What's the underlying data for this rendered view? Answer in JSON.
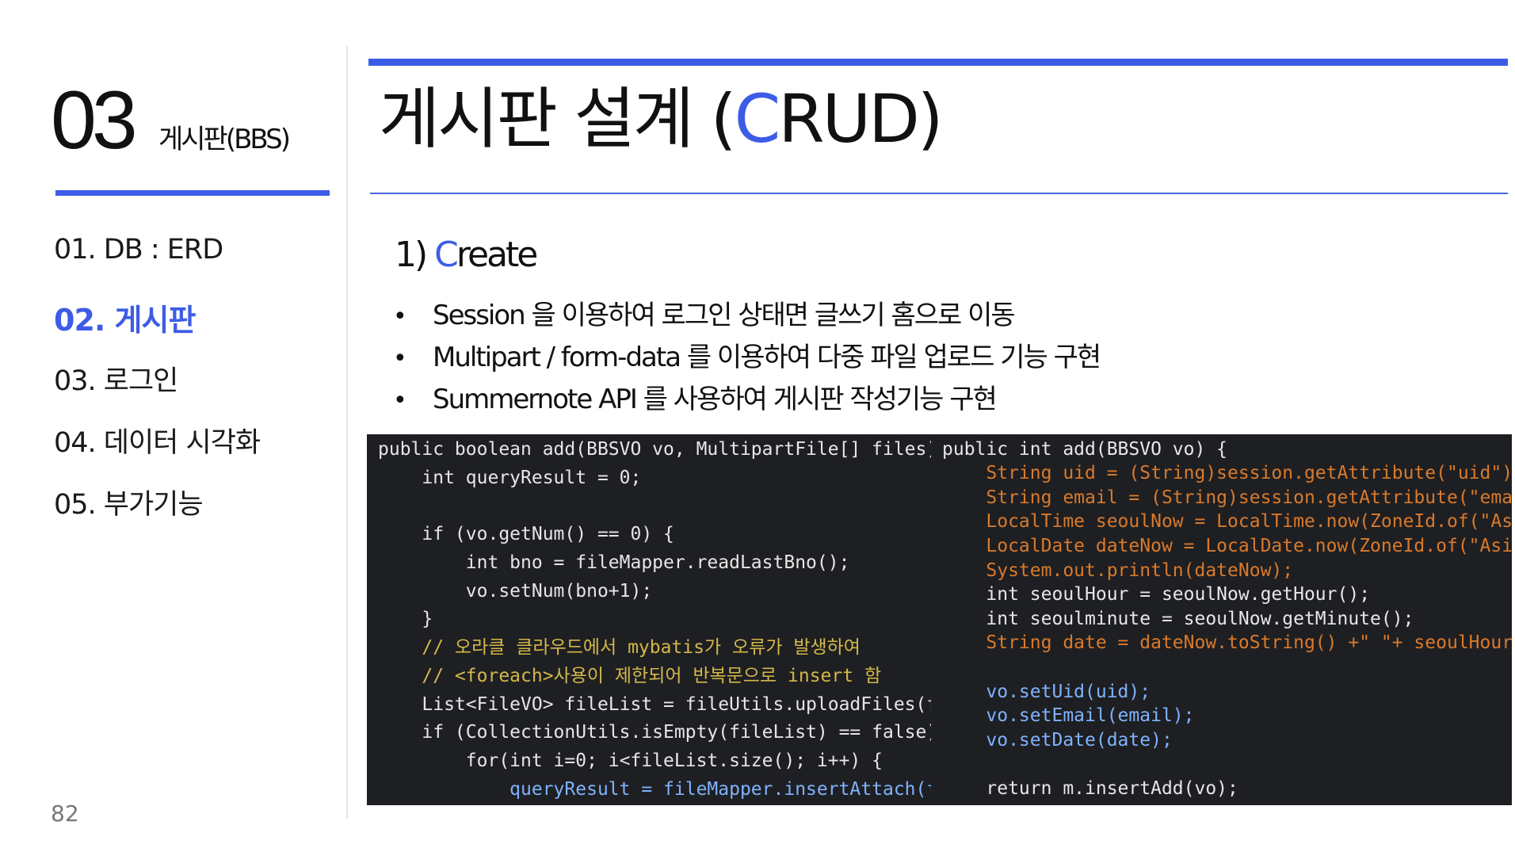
{
  "sidebar": {
    "section_number": "03",
    "section_name": "게시판(BBS)",
    "items": [
      {
        "label": "01. DB : ERD",
        "active": false
      },
      {
        "label": "02. 게시판",
        "active": true
      },
      {
        "label": "03. 로그인",
        "active": false
      },
      {
        "label": "04. 데이터 시각화",
        "active": false
      },
      {
        "label": "05. 부가기능",
        "active": false
      }
    ],
    "page_number": "82"
  },
  "header": {
    "title_prefix": "게시판 설계 (",
    "title_accent": "C",
    "title_suffix": "RUD)"
  },
  "content": {
    "sub_heading_prefix": "1) ",
    "sub_heading_accent": "C",
    "sub_heading_suffix": "reate",
    "bullets": [
      "Session 을 이용하여 로그인 상태면 글쓰기 홈으로 이동",
      "Multipart / form-data 를 이용하여 다중 파일 업로드 기능 구현",
      "Summernote API 를 사용하여 게시판 작성기능 구현"
    ],
    "bullet_symbol": "•"
  },
  "code_left": [
    "public boolean add(BBSVO vo, MultipartFile[] files) {",
    "    int queryResult = 0;",
    "",
    "    if (vo.getNum() == 0) {",
    "        int bno = fileMapper.readLastBno();",
    "        vo.setNum(bno+1);",
    "    }",
    "    // 오라클 클라우드에서 mybatis가 오류가 발생하여",
    "    // <foreach>사용이 제한되어 반복문으로 insert 함",
    "    List<FileVO> fileList = fileUtils.uploadFiles(files, vo.getNum());",
    "    if (CollectionUtils.isEmpty(fileList) == false) {",
    "        for(int i=0; i<fileList.size(); i++) {",
    "            queryResult = fileMapper.insertAttach(fileList.get(i));"
  ],
  "code_right": [
    "public int add(BBSVO vo) {",
    "    String uid = (String)session.getAttribute(\"uid\");",
    "    String email = (String)session.getAttribute(\"email\");",
    "    LocalTime seoulNow = LocalTime.now(ZoneId.of(\"Asia/Seoul\"));",
    "    LocalDate dateNow = LocalDate.now(ZoneId.of(\"Asia/Seoul\"));",
    "    System.out.println(dateNow);",
    "    int seoulHour = seoulNow.getHour();",
    "    int seoulminute = seoulNow.getMinute();",
    "    String date = dateNow.toString() +\" \"+ seoulHour +\":\" +seoulminute;",
    "",
    "    vo.setUid(uid);",
    "    vo.setEmail(email);",
    "    vo.setDate(date);",
    "",
    "    return m.insertAdd(vo);"
  ],
  "colors": {
    "accent": "#3d5ce6",
    "code_bg": "#1e1f22"
  }
}
